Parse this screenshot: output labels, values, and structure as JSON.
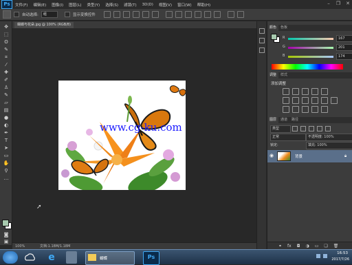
{
  "menu": {
    "logo": "Ps",
    "items": [
      "文件(F)",
      "编辑(E)",
      "图像(I)",
      "图层(L)",
      "类型(Y)",
      "选择(S)",
      "滤镜(T)",
      "3D(D)",
      "视图(V)",
      "窗口(W)",
      "帮助(H)"
    ]
  },
  "options_bar": {
    "mode_label": "自动选择:",
    "mode_value": "组",
    "transform_label": "显示变换控件"
  },
  "document": {
    "tab_title": "蝴蝶与花朵.jpg @ 100% (RGB/8)",
    "watermark": "www.cg-ku.com"
  },
  "status": {
    "zoom": "100%",
    "doc_size": "文档:1.18M/1.18M"
  },
  "color_panel": {
    "tabs": [
      "颜色",
      "色板"
    ],
    "r_label": "R",
    "r_value": "167",
    "g_label": "G",
    "g_value": "201",
    "b_label": "B",
    "b_value": "174"
  },
  "adjustments_panel": {
    "tabs": [
      "调整",
      "样式"
    ],
    "title": "添加调整"
  },
  "layers_panel": {
    "tabs": [
      "图层",
      "通道",
      "路径"
    ],
    "kind_label": "类型",
    "blend_mode": "正常",
    "opacity": "不透明度: 100%",
    "lock_label": "锁定:",
    "fill": "填充: 100%",
    "layer_name": "背景"
  },
  "taskbar": {
    "ie_label": "e",
    "folder_label": "蝴蝶",
    "ps_label": "Ps",
    "time": "16:53",
    "date": "2017/7/26"
  },
  "colors": {
    "foreground": "#a7c9ae",
    "background": "#ffffff"
  }
}
